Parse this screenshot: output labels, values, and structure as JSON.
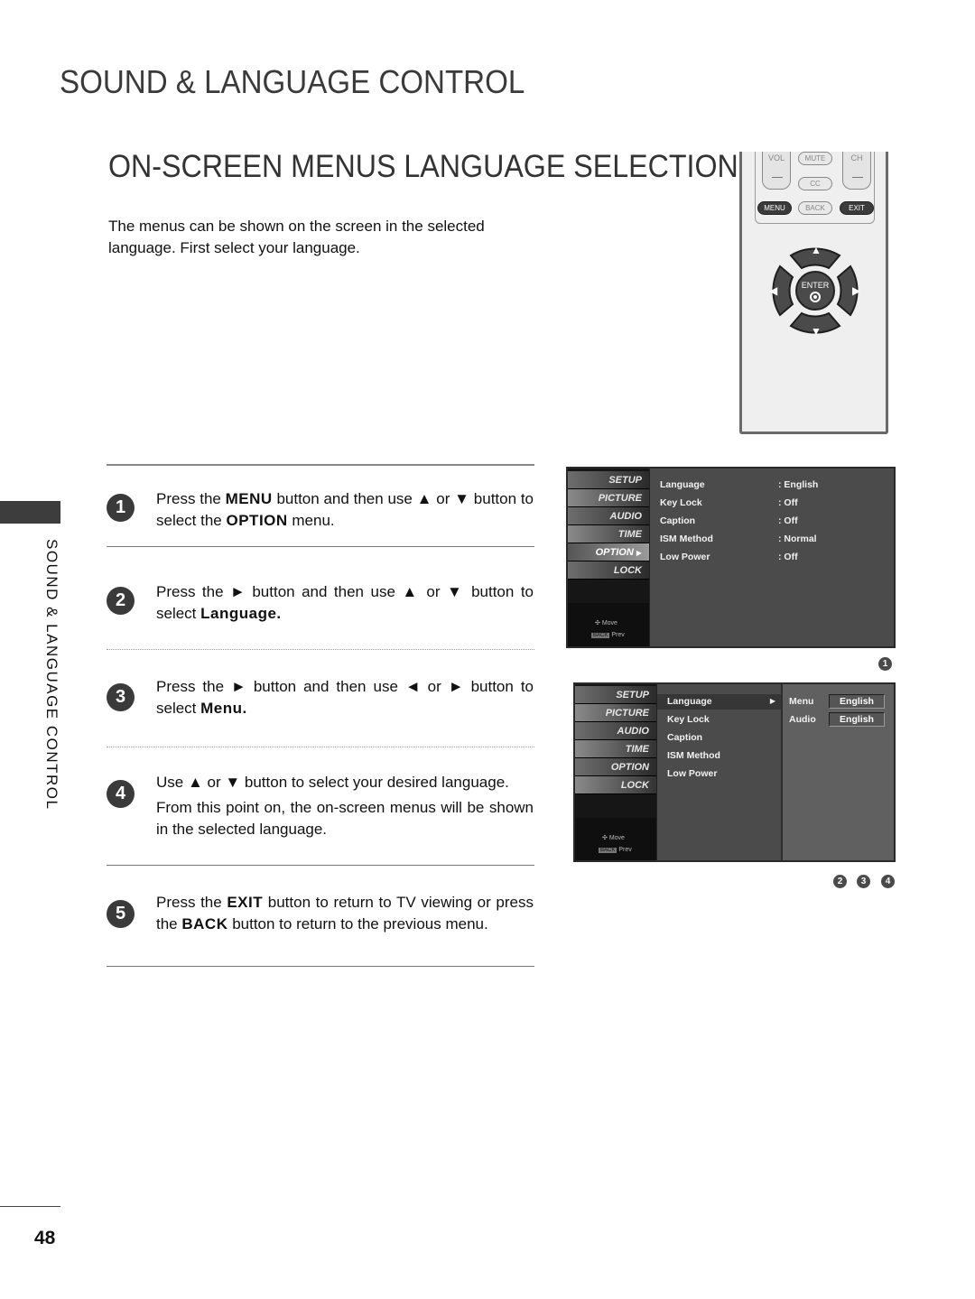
{
  "header": {
    "section_title": "SOUND & LANGUAGE CONTROL",
    "page_title": "ON-SCREEN MENUS LANGUAGE SELECTION",
    "intro": "The menus can be shown on the screen in the selected language. First select your language."
  },
  "sidebar": {
    "label": "SOUND & LANGUAGE CONTROL"
  },
  "steps": [
    {
      "num": "1",
      "pre": "Press the ",
      "b1": "MENU",
      "mid": " button and then use ▲ or ▼ button to select the ",
      "b2": "OPTION",
      "post": " menu."
    },
    {
      "num": "2",
      "pre": "Press the ► button and then use ▲ or ▼ button to select ",
      "b1": "Language.",
      "post": ""
    },
    {
      "num": "3",
      "pre": "Press the ► button and then use ◄ or ► button to select ",
      "b1": "Menu.",
      "post": ""
    },
    {
      "num": "4",
      "line1": "Use ▲ or ▼ button to select your desired language.",
      "line2": "From this point on, the on-screen menus will be shown in the selected language."
    },
    {
      "num": "5",
      "pre": "Press the ",
      "b1": "EXIT",
      "mid": " button to return to TV viewing or press the ",
      "b2": "BACK",
      "post": " button to return to the previous menu."
    }
  ],
  "remote": {
    "vol": "VOL",
    "mute": "MUTE",
    "ch": "CH",
    "cc": "CC",
    "menu": "MENU",
    "back": "BACK",
    "exit": "EXIT",
    "enter": "ENTER",
    "up": "▲",
    "down": "▼",
    "left": "◀",
    "right": "▶"
  },
  "osd1": {
    "menu_items": [
      "SETUP",
      "PICTURE",
      "AUDIO",
      "TIME",
      "OPTION",
      "LOCK"
    ],
    "selected": "OPTION",
    "help_move": "Move",
    "help_back": "BACK",
    "help_prev": "Prev",
    "rows": [
      {
        "label": "Language",
        "value": ": English"
      },
      {
        "label": "Key Lock",
        "value": ": Off"
      },
      {
        "label": "Caption",
        "value": ": Off"
      },
      {
        "label": "ISM Method",
        "value": ": Normal"
      },
      {
        "label": "Low Power",
        "value": ": Off"
      }
    ],
    "ref": "1"
  },
  "osd2": {
    "menu_items": [
      "SETUP",
      "PICTURE",
      "AUDIO",
      "TIME",
      "OPTION",
      "LOCK"
    ],
    "help_move": "Move",
    "help_back": "BACK",
    "help_prev": "Prev",
    "rows": [
      "Language",
      "Key Lock",
      "Caption",
      "ISM Method",
      "Low Power"
    ],
    "row_arrow": "▶",
    "sub": [
      {
        "label": "Menu",
        "value": "English"
      },
      {
        "label": "Audio",
        "value": "English"
      }
    ],
    "refs": [
      "2",
      "3",
      "4"
    ]
  },
  "footer": {
    "page_number": "48"
  }
}
